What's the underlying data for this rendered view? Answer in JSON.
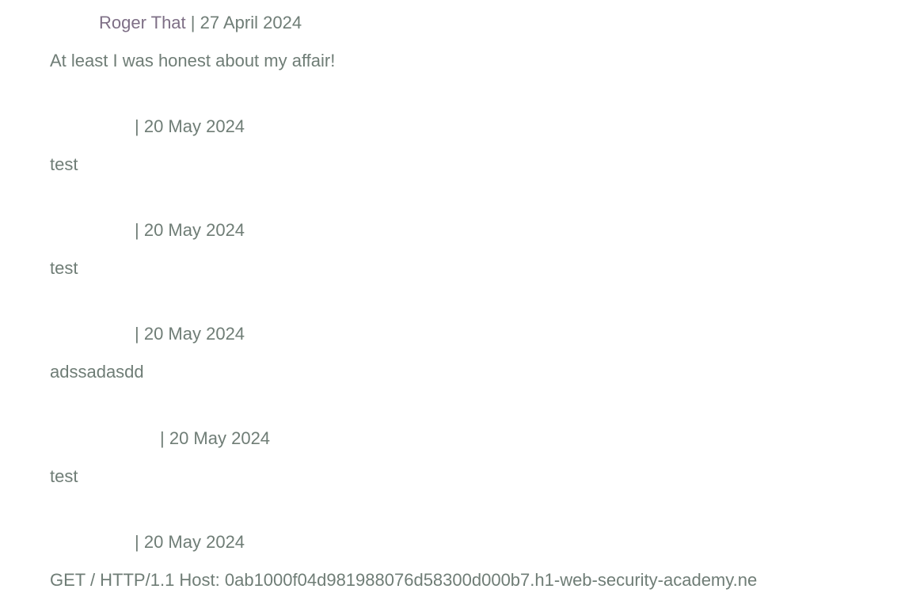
{
  "comments": [
    {
      "author": "Roger That",
      "separator": "|",
      "date": "27 April 2024",
      "text": "At least I was honest about my affair!"
    },
    {
      "author": "",
      "separator": "|",
      "date": "20 May 2024",
      "text": "test"
    },
    {
      "author": "",
      "separator": "|",
      "date": "20 May 2024",
      "text": "test"
    },
    {
      "author": "",
      "separator": "|",
      "date": "20 May 2024",
      "text": "adssadasdd"
    },
    {
      "author": "",
      "separator": "|",
      "date": "20 May 2024",
      "text": "test"
    },
    {
      "author": "",
      "separator": "|",
      "date": "20 May 2024",
      "text": "GET / HTTP/1.1 Host: 0ab1000f04d981988076d58300d000b7.h1-web-security-academy.ne"
    }
  ]
}
